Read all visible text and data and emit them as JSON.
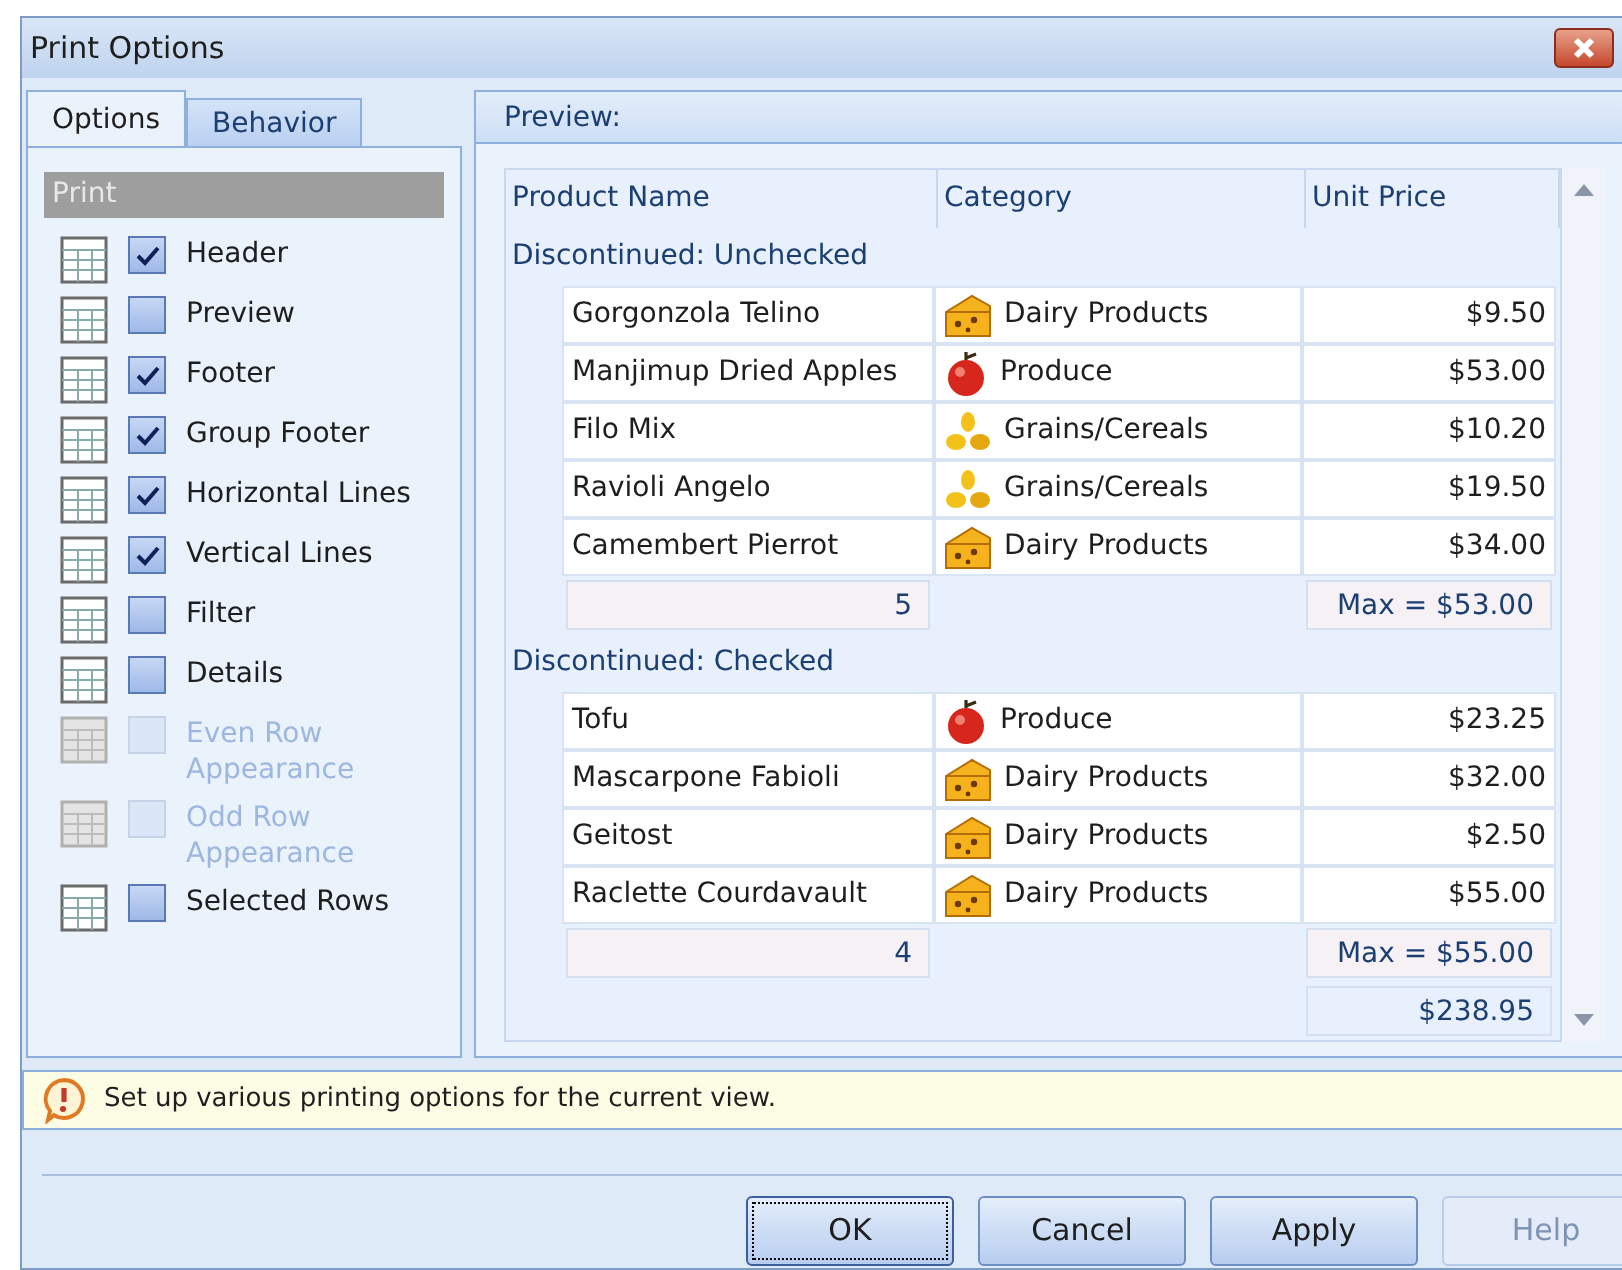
{
  "window": {
    "title": "Print Options"
  },
  "tabs": [
    {
      "label": "Options",
      "selected": true
    },
    {
      "label": "Behavior",
      "selected": false
    }
  ],
  "print_section": {
    "title": "Print",
    "options": [
      {
        "label": "Header",
        "checked": true,
        "disabled": false
      },
      {
        "label": "Preview",
        "checked": false,
        "disabled": false
      },
      {
        "label": "Footer",
        "checked": true,
        "disabled": false
      },
      {
        "label": "Group Footer",
        "checked": true,
        "disabled": false
      },
      {
        "label": "Horizontal Lines",
        "checked": true,
        "disabled": false
      },
      {
        "label": "Vertical Lines",
        "checked": true,
        "disabled": false
      },
      {
        "label": "Filter",
        "checked": false,
        "disabled": false
      },
      {
        "label": "Details",
        "checked": false,
        "disabled": false
      },
      {
        "label": "Even Row Appearance",
        "checked": false,
        "disabled": true
      },
      {
        "label": "Odd Row Appearance",
        "checked": false,
        "disabled": true
      },
      {
        "label": "Selected Rows",
        "checked": false,
        "disabled": false
      }
    ]
  },
  "preview": {
    "title": "Preview:",
    "columns": [
      "Product Name",
      "Category",
      "Unit Price"
    ],
    "groups": [
      {
        "label": "Discontinued: Unchecked",
        "rows": [
          {
            "name": "Gorgonzola Telino",
            "kind": "dairy",
            "category": "Dairy Products",
            "price": "$9.50"
          },
          {
            "name": "Manjimup Dried Apples",
            "kind": "produce",
            "category": "Produce",
            "price": "$53.00"
          },
          {
            "name": "Filo Mix",
            "kind": "grain",
            "category": "Grains/Cereals",
            "price": "$10.20"
          },
          {
            "name": "Ravioli Angelo",
            "kind": "grain",
            "category": "Grains/Cereals",
            "price": "$19.50"
          },
          {
            "name": "Camembert Pierrot",
            "kind": "dairy",
            "category": "Dairy Products",
            "price": "$34.00"
          }
        ],
        "count": "5",
        "max": "Max = $53.00"
      },
      {
        "label": "Discontinued: Checked",
        "rows": [
          {
            "name": "Tofu",
            "kind": "produce",
            "category": "Produce",
            "price": "$23.25"
          },
          {
            "name": "Mascarpone Fabioli",
            "kind": "dairy",
            "category": "Dairy Products",
            "price": "$32.00"
          },
          {
            "name": "Geitost",
            "kind": "dairy",
            "category": "Dairy Products",
            "price": "$2.50"
          },
          {
            "name": "Raclette Courdavault",
            "kind": "dairy",
            "category": "Dairy Products",
            "price": "$55.00"
          }
        ],
        "count": "4",
        "max": "Max = $55.00"
      }
    ],
    "total": "$238.95"
  },
  "info": "Set up various printing options for the current view.",
  "buttons": [
    {
      "label": "OK",
      "disabled": false,
      "default": true
    },
    {
      "label": "Cancel",
      "disabled": false,
      "default": false
    },
    {
      "label": "Apply",
      "disabled": false,
      "default": false
    },
    {
      "label": "Help",
      "disabled": true,
      "default": false
    }
  ]
}
